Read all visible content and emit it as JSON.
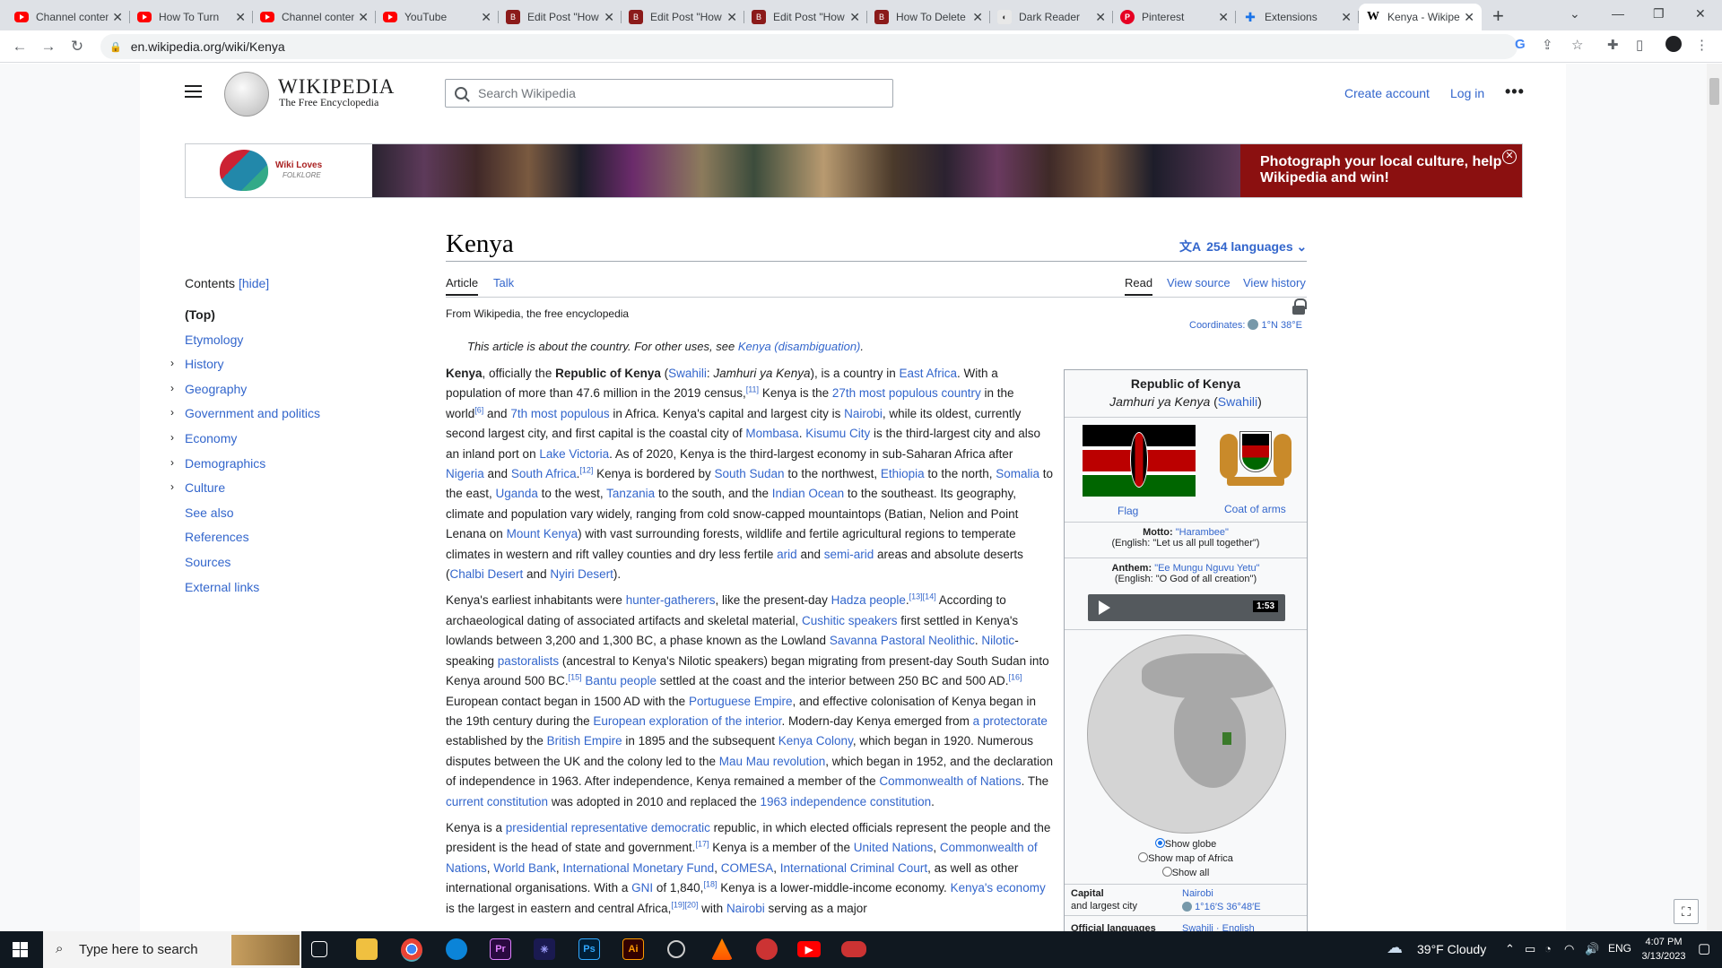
{
  "browser": {
    "tabs": [
      {
        "title": "Channel content",
        "icon": "youtube-icon"
      },
      {
        "title": "How To Turn",
        "icon": "youtube-icon"
      },
      {
        "title": "Channel content",
        "icon": "youtube-icon"
      },
      {
        "title": "YouTube",
        "icon": "youtube-icon"
      },
      {
        "title": "Edit Post \"How",
        "icon": "blogger-icon"
      },
      {
        "title": "Edit Post \"How",
        "icon": "blogger-icon"
      },
      {
        "title": "Edit Post \"How",
        "icon": "blogger-icon"
      },
      {
        "title": "How To Delete",
        "icon": "blogger-icon"
      },
      {
        "title": "Dark Reader",
        "icon": "dark-reader-icon"
      },
      {
        "title": "Pinterest",
        "icon": "pinterest-icon"
      },
      {
        "title": "Extensions",
        "icon": "puzzle-icon"
      },
      {
        "title": "Kenya - Wikipedia",
        "icon": "wikipedia-icon"
      }
    ],
    "url": "en.wikipedia.org/wiki/Kenya"
  },
  "wiki": {
    "wordmark": "WIKIPEDIA",
    "tagline": "The Free Encyclopedia",
    "search_placeholder": "Search Wikipedia",
    "create_account": "Create account",
    "log_in": "Log in",
    "banner": {
      "logo_text": "Wiki Loves",
      "logo_sub": "FOLKLORE",
      "message": "Photograph your local culture, help Wikipedia and win!"
    },
    "toc": {
      "label": "Contents",
      "hide": "[hide]",
      "items": [
        "(Top)",
        "Etymology",
        "History",
        "Geography",
        "Government and politics",
        "Economy",
        "Demographics",
        "Culture",
        "See also",
        "References",
        "Sources",
        "External links"
      ]
    },
    "title": "Kenya",
    "languages": "254 languages",
    "tabs": {
      "article": "Article",
      "talk": "Talk",
      "read": "Read",
      "view_source": "View source",
      "view_history": "View history"
    },
    "from": "From Wikipedia, the free encyclopedia",
    "coordinates_label": "Coordinates:",
    "coordinates": "1°N 38°E",
    "hatnote": "This article is about the country. For other uses, see",
    "hatnote_link": "Kenya (disambiguation)",
    "infobox": {
      "title": "Republic of Kenya",
      "native": "Jamhuri ya Kenya",
      "native_lang": "Swahili",
      "flag_caption": "Flag",
      "coa_caption": "Coat of arms",
      "motto_label": "Motto:",
      "motto": "\"Harambee\"",
      "motto_en": "(English: \"Let us all pull together\")",
      "anthem_label": "Anthem:",
      "anthem": "\"Ee Mungu Nguvu Yetu\"",
      "anthem_en": "(English: \"O God of all creation\")",
      "duration": "1:53",
      "map_opt1": "Show globe",
      "map_opt2": "Show map of Africa",
      "map_opt3": "Show all",
      "capital_label": "Capital",
      "capital_label2": "and largest city",
      "capital": "Nairobi",
      "capital_coords": "1°16′S 36°48′E",
      "official_label": "Official languages",
      "official": "Swahili · English"
    }
  },
  "taskbar": {
    "search_placeholder": "Type here to search",
    "weather": "39°F  Cloudy",
    "lang": "ENG",
    "time": "4:07 PM",
    "date": "3/13/2023"
  },
  "colors": {
    "link": "#3366cc",
    "banner_red": "#8b1010",
    "taskbar": "#101820"
  }
}
